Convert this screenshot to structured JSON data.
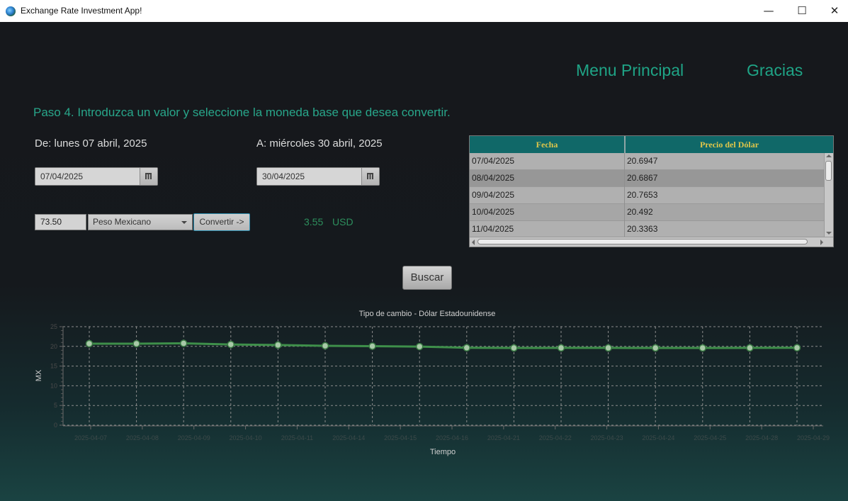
{
  "window": {
    "title": "Exchange Rate Investment App!",
    "minimize_glyph": "—",
    "maximize_glyph": "☐",
    "close_glyph": "✕"
  },
  "nav": {
    "menu_principal": "Menu Principal",
    "gracias": "Gracias"
  },
  "step_text": "Paso 4. Introduzca un valor y seleccione la moneda base que desea convertir.",
  "from": {
    "label": "De: lunes 07 abril, 2025",
    "value": "07/04/2025"
  },
  "to": {
    "label": "A: miércoles 30 abril, 2025",
    "value": "30/04/2025"
  },
  "converter": {
    "amount": "73.50",
    "currency": "Peso Mexicano",
    "convert_label": "Convertir ->",
    "result_value": "3.55",
    "result_currency": "USD"
  },
  "table": {
    "headers": [
      "Fecha",
      "Precio del Dólar"
    ],
    "rows": [
      [
        "07/04/2025",
        "20.6947"
      ],
      [
        "08/04/2025",
        "20.6867"
      ],
      [
        "09/04/2025",
        "20.7653"
      ],
      [
        "10/04/2025",
        "20.492"
      ],
      [
        "11/04/2025",
        "20.3363"
      ]
    ],
    "selected_row": 1
  },
  "search_button": "Buscar",
  "colors": {
    "accent": "#1fa486",
    "header_bg": "#106868",
    "header_text": "#e0c64a",
    "line": "#3e8f4a"
  },
  "chart_data": {
    "type": "line",
    "title": "Tipo de cambio - Dólar Estadounidense",
    "xlabel": "Tiempo",
    "ylabel": "MX",
    "ylim": [
      0,
      25
    ],
    "yticks": [
      0,
      5,
      10,
      15,
      20,
      25
    ],
    "grid": true,
    "categories": [
      "2025-04-07",
      "2025-04-08",
      "2025-04-09",
      "2025-04-10",
      "2025-04-11",
      "2025-04-14",
      "2025-04-15",
      "2025-04-16",
      "2025-04-21",
      "2025-04-22",
      "2025-04-23",
      "2025-04-24",
      "2025-04-25",
      "2025-04-28",
      "2025-04-29"
    ],
    "values": [
      20.69,
      20.69,
      20.77,
      20.49,
      20.34,
      20.15,
      20.05,
      19.95,
      19.65,
      19.6,
      19.62,
      19.62,
      19.6,
      19.6,
      19.63,
      19.66
    ]
  }
}
